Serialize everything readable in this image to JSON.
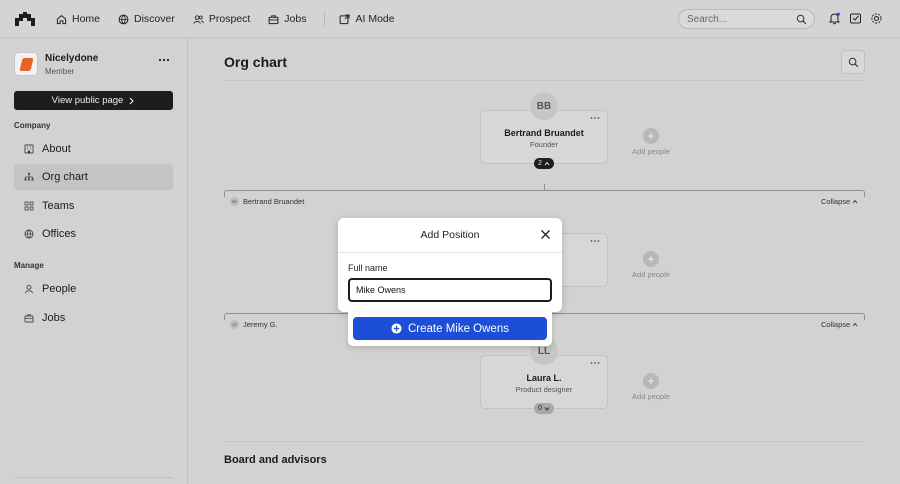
{
  "nav": {
    "items": [
      {
        "label": "Home",
        "icon": "home-icon"
      },
      {
        "label": "Discover",
        "icon": "globe-icon"
      },
      {
        "label": "Prospect",
        "icon": "users-icon"
      },
      {
        "label": "Jobs",
        "icon": "briefcase-icon"
      },
      {
        "label": "AI Mode",
        "icon": "ai-mode-icon"
      }
    ],
    "search_placeholder": "Search..."
  },
  "sidebar": {
    "org_name": "Nicelydone",
    "org_role": "Member",
    "public_button": "View public page",
    "company_label": "Company",
    "company_items": [
      {
        "label": "About",
        "icon": "building-icon"
      },
      {
        "label": "Org chart",
        "icon": "org-chart-icon",
        "active": true
      },
      {
        "label": "Teams",
        "icon": "teams-icon"
      },
      {
        "label": "Offices",
        "icon": "globe-icon"
      }
    ],
    "manage_label": "Manage",
    "manage_items": [
      {
        "label": "People",
        "icon": "people-icon"
      },
      {
        "label": "Jobs",
        "icon": "briefcase-icon"
      }
    ]
  },
  "main": {
    "title": "Org chart",
    "root": {
      "initials": "BB",
      "name": "Bertrand Bruandet",
      "role": "Founder",
      "count": "2"
    },
    "group1": {
      "label": "Bertrand Bruandet",
      "initials": "BB",
      "collapse": "Collapse"
    },
    "group2": {
      "label": "Jeremy G.",
      "initials": "JG",
      "collapse": "Collapse"
    },
    "laura": {
      "initials": "LL",
      "name": "Laura L.",
      "role": "Product designer",
      "count": "0"
    },
    "add_people": "Add people",
    "board_title": "Board and advisors"
  },
  "modal": {
    "title": "Add Position",
    "field_label": "Full name",
    "field_value": "Mike Owens",
    "create_label": "Create Mike Owens"
  },
  "colors": {
    "accent": "#1c4ed8",
    "background": "#d2d2d2",
    "brand": "#e8632c"
  }
}
